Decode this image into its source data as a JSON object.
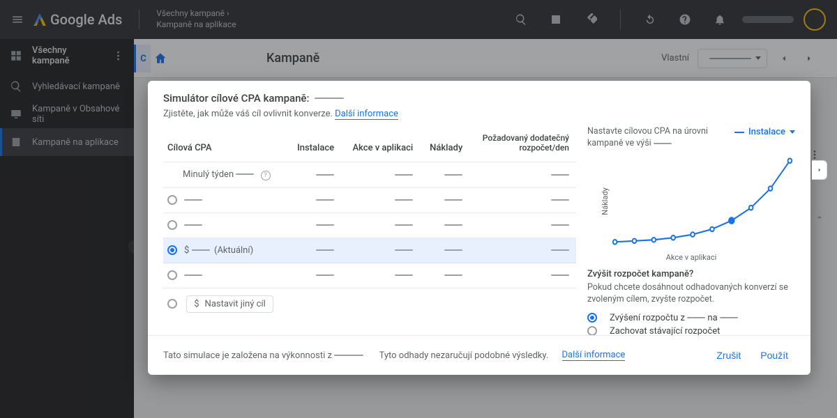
{
  "header": {
    "product": "Google Ads",
    "breadcrumb_top": "Všechny kampaně",
    "breadcrumb_bottom": "Kampaně na aplikace"
  },
  "sidebar": {
    "items": [
      {
        "label": "Všechny kampaně"
      },
      {
        "label": "Vyhledávací kampaně"
      },
      {
        "label": "Kampaně v Obsahové síti"
      },
      {
        "label": "Kampaně na aplikace"
      }
    ]
  },
  "page": {
    "title": "Kampaně",
    "date_label": "Vlastní"
  },
  "modal": {
    "title": "Simulátor cílové CPA kampaně:",
    "subtitle": "Zjistěte, jak může váš cíl ovlivnit konverze.",
    "learn_more": "Další informace",
    "cols": {
      "c1": "Cílová CPA",
      "c2": "Instalace",
      "c3": "Akce v aplikaci",
      "c4": "Náklady",
      "c5a": "Požadovaný dodatečný",
      "c5b": "rozpočet/den"
    },
    "last_week": "Minulý týden",
    "currency": "$",
    "current_tag": "(Aktuální)",
    "other_prefix": "$",
    "other_label": "Nastavit jiný cíl",
    "right_lead": "Nastavte cílovou CPA na úrovni kampaně ve výši",
    "chip": "Instalace",
    "ylabel": "Náklady",
    "xlabel": "Akce v aplikaci",
    "budget_q": "Zvýšit rozpočet kampaně?",
    "budget_p": "Pokud chcete dosáhnout odhadovaných konverzí se zvoleným cílem, zvyšte rozpočet.",
    "budget_opt1_a": "Zvýšení rozpočtu z",
    "budget_opt1_b": "na",
    "budget_opt2": "Zachovat stávající rozpočet",
    "footer_a": "Tato simulace je založena na výkonnosti z",
    "footer_b": "Tyto odhady nezaručují podobné výsledky.",
    "cancel": "Zrušit",
    "apply": "Použít"
  },
  "chart_data": {
    "type": "line",
    "x": [
      0,
      1,
      2,
      3,
      4,
      5,
      6,
      7,
      8,
      9
    ],
    "y": [
      2,
      3,
      4,
      6,
      9,
      14,
      22,
      34,
      52,
      78
    ],
    "highlight_index": 6,
    "xlabel": "Akce v aplikaci",
    "ylabel": "Náklady",
    "ylim": [
      0,
      80
    ],
    "series_name": "Instalace"
  }
}
